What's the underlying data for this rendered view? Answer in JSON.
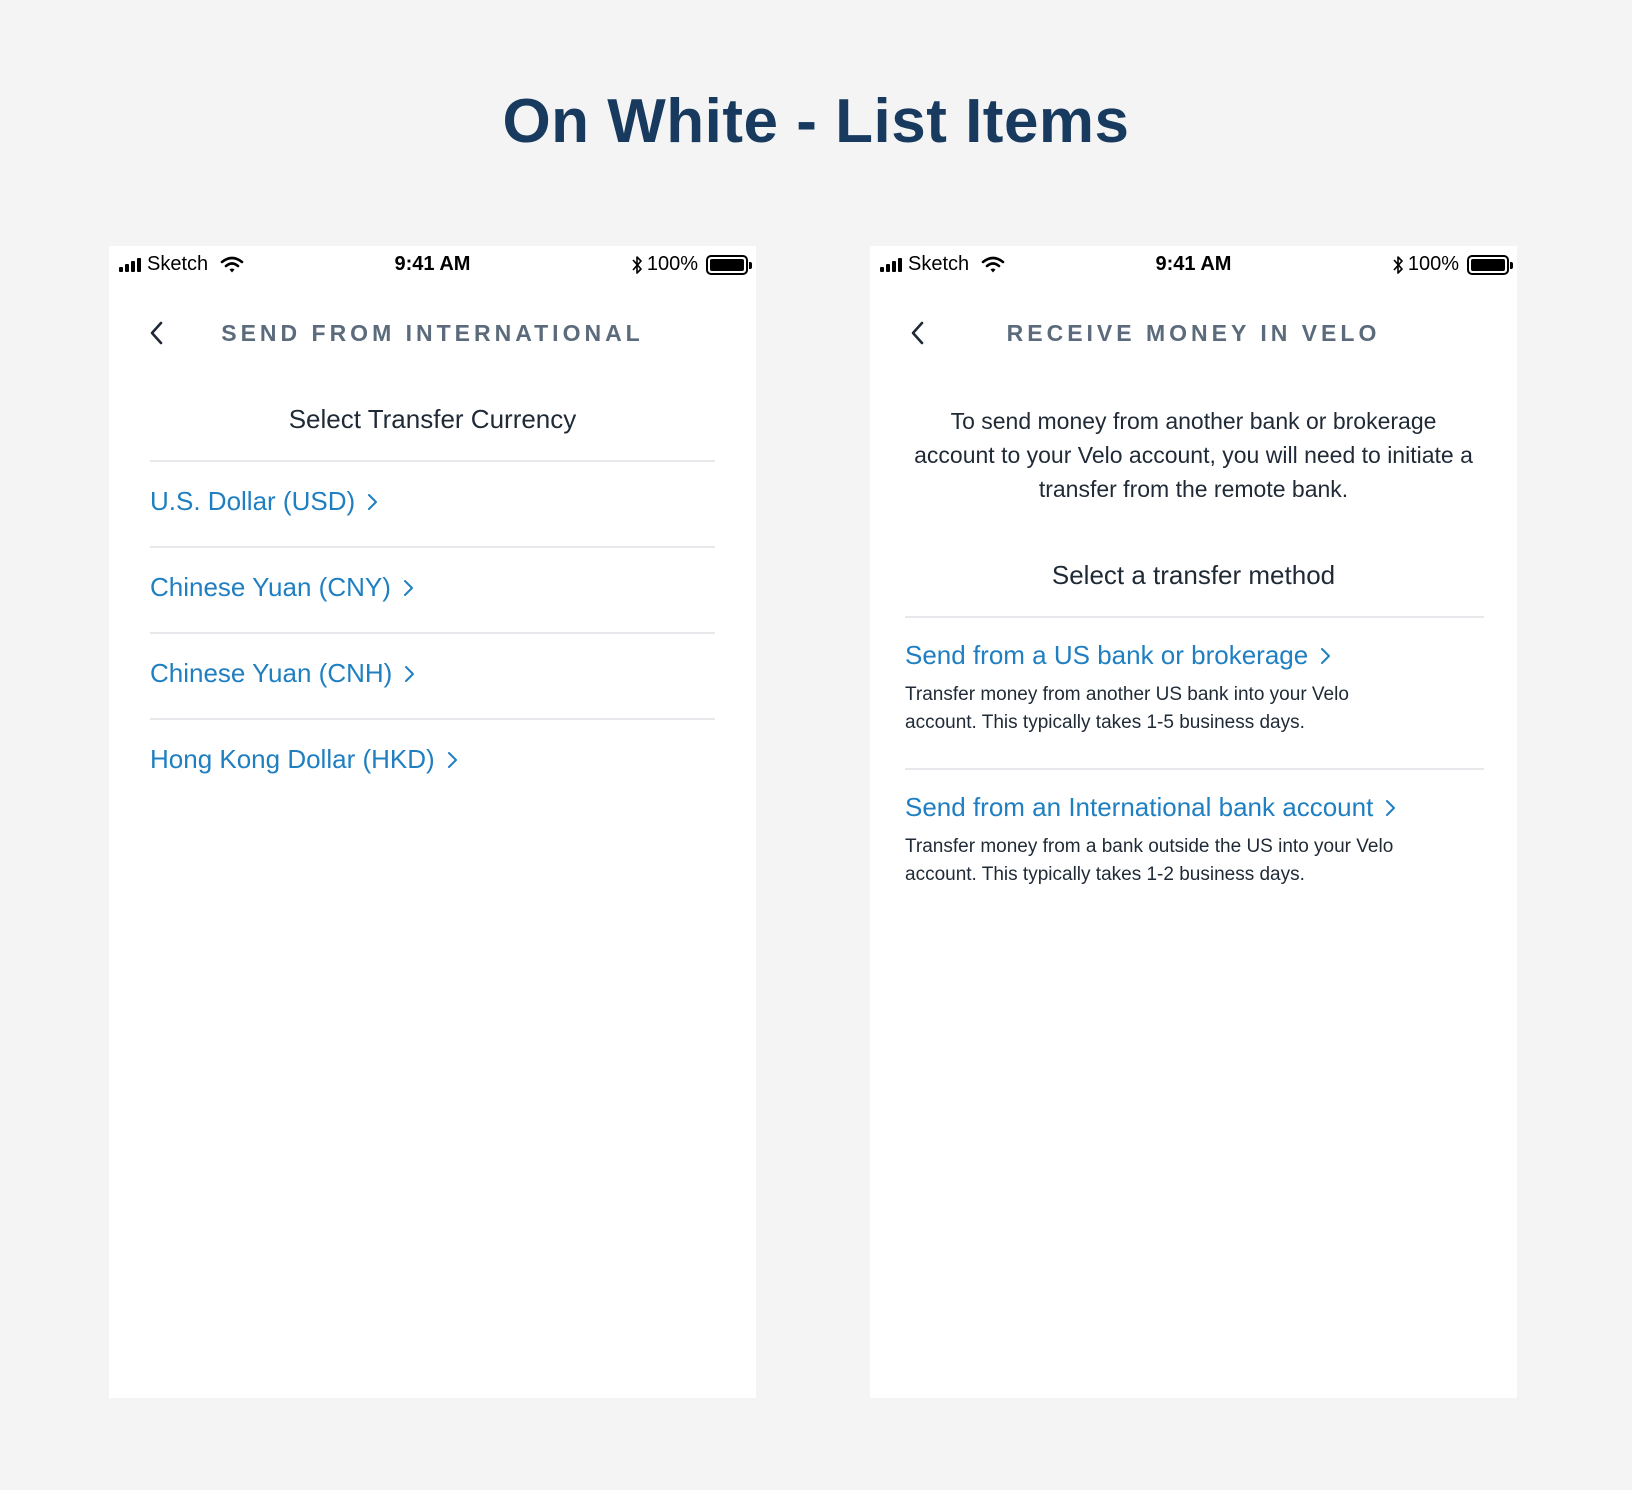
{
  "page": {
    "title": "On White - List Items"
  },
  "status_bar": {
    "carrier": "Sketch",
    "time": "9:41 AM",
    "battery": "100%"
  },
  "left_screen": {
    "nav_title": "SEND FROM INTERNATIONAL",
    "section_title": "Select Transfer Currency",
    "items": [
      {
        "label": "U.S. Dollar (USD)"
      },
      {
        "label": "Chinese Yuan (CNY)"
      },
      {
        "label": "Chinese Yuan (CNH)"
      },
      {
        "label": "Hong Kong Dollar (HKD)"
      }
    ]
  },
  "right_screen": {
    "nav_title": "RECEIVE MONEY IN VELO",
    "intro": "To send money from another bank or brokerage account to your Velo account, you will need to initiate a transfer from the remote bank.",
    "section_title": "Select a transfer method",
    "methods": [
      {
        "label": "Send from a US bank or brokerage",
        "description": "Transfer money from another US bank into your Velo account. This typically takes 1-5 business days."
      },
      {
        "label": "Send from an International bank account",
        "description": "Transfer money from a bank outside the US into your Velo account. This typically takes 1-2 business days."
      }
    ]
  },
  "colors": {
    "background": "#f4f4f4",
    "title": "#173a5e",
    "link": "#1f7fc1",
    "nav_title": "#5c6b7c",
    "divider": "#e6e8eb"
  },
  "icons": [
    "signal-icon",
    "wifi-icon",
    "bluetooth-icon",
    "battery-icon",
    "back-chevron-icon",
    "chevron-right-icon"
  ]
}
